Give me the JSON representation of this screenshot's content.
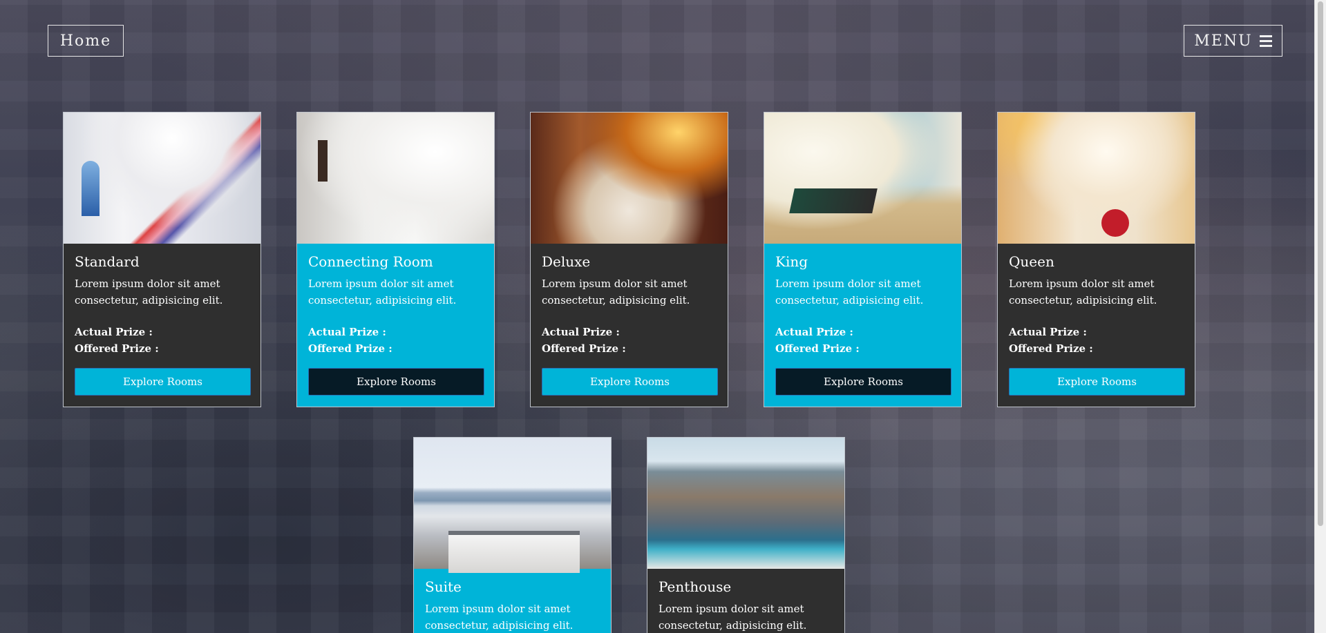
{
  "nav": {
    "home_label": "Home",
    "menu_label": "MENU",
    "menu_icon": "hamburger-icon"
  },
  "cards": {
    "standard": {
      "title": "Standard",
      "desc": "Lorem ipsum dolor sit amet consectetur, adipisicing elit.",
      "actual_prize": "Actual Prize :",
      "offered_prize": "Offered Prize :",
      "button": "Explore Rooms"
    },
    "connecting": {
      "title": "Connecting Room",
      "desc": "Lorem ipsum dolor sit amet consectetur, adipisicing elit.",
      "actual_prize": "Actual Prize :",
      "offered_prize": "Offered Prize :",
      "button": "Explore Rooms"
    },
    "deluxe": {
      "title": "Deluxe",
      "desc": "Lorem ipsum dolor sit amet consectetur, adipisicing elit.",
      "actual_prize": "Actual Prize :",
      "offered_prize": "Offered Prize :",
      "button": "Explore Rooms"
    },
    "king": {
      "title": "King",
      "desc": "Lorem ipsum dolor sit amet consectetur, adipisicing elit.",
      "actual_prize": "Actual Prize :",
      "offered_prize": "Offered Prize :",
      "button": "Explore Rooms"
    },
    "queen": {
      "title": "Queen",
      "desc": "Lorem ipsum dolor sit amet consectetur, adipisicing elit.",
      "actual_prize": "Actual Prize :",
      "offered_prize": "Offered Prize :",
      "button": "Explore Rooms"
    },
    "suite": {
      "title": "Suite",
      "desc": "Lorem ipsum dolor sit amet consectetur, adipisicing elit."
    },
    "penthouse": {
      "title": "Penthouse",
      "desc": "Lorem ipsum dolor sit amet consectetur, adipisicing elit."
    }
  },
  "colors": {
    "card_dark": "#2f2f2f",
    "card_blue": "#00b4d8",
    "button_blue": "#00b4d8",
    "button_dark": "#061b26"
  }
}
